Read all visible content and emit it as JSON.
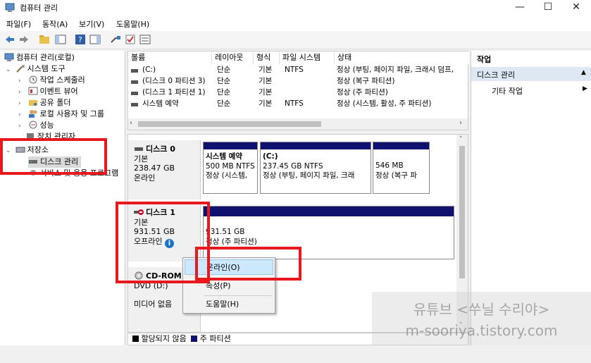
{
  "window": {
    "title": "컴퓨터 관리",
    "minimize": "—",
    "maximize": "☐",
    "close": "✕"
  },
  "menu": [
    "파일(F)",
    "동작(A)",
    "보기(V)",
    "도움말(H)"
  ],
  "tree": {
    "root": "컴퓨터 관리(로컬)",
    "system_tools": "시스템 도구",
    "task_scheduler": "작업 스케줄러",
    "event_viewer": "이벤트 뷰어",
    "shared_folders": "공유 폴더",
    "local_users": "로컬 사용자 및 그룹",
    "performance": "성능",
    "device_manager": "장치 관리자",
    "storage": "저장소",
    "disk_management": "디스크 관리",
    "services": "서비스 및 응용 프로그램"
  },
  "table": {
    "headers": [
      "볼륨",
      "레이아웃",
      "형식",
      "파일 시스템",
      "상태"
    ],
    "rows": [
      [
        "(C:)",
        "단순",
        "기본",
        "NTFS",
        "정상 (부팅, 페이지 파일, 크래시 덤프,"
      ],
      [
        "(디스크 0 파티션 3)",
        "단순",
        "기본",
        "",
        "정상 (복구 파티션)"
      ],
      [
        "(디스크 1 파티션 1)",
        "단순",
        "기본",
        "",
        "정상 (주 파티션)"
      ],
      [
        "시스템 예약",
        "단순",
        "기본",
        "NTFS",
        "정상 (시스템, 활성, 주 파티션)"
      ]
    ]
  },
  "disk0": {
    "name": "디스크 0",
    "type": "기본",
    "size": "238.47 GB",
    "status": "온라인",
    "partitions": [
      {
        "name": "시스템 예약",
        "size": "500 MB NTFS",
        "status": "정상 (시스템,"
      },
      {
        "name": "(C:)",
        "size": "237.45 GB NTFS",
        "status": "정상 (부팅, 페이지 파일, 크래"
      },
      {
        "name": "",
        "size": "546 MB",
        "status": "정상 (복구 파"
      }
    ]
  },
  "disk1": {
    "name": "디스크 1",
    "type": "기본",
    "size": "931.51 GB",
    "status": "오프라인",
    "partition": {
      "size": "931.51 GB",
      "status": "정상 (주 파티션)"
    }
  },
  "cdrom": {
    "name": "CD-ROM",
    "drive": "DVD (D:)",
    "status": "미디어 없음"
  },
  "legend": {
    "unallocated": "할당되지 않음",
    "primary": "주 파티션"
  },
  "actions": {
    "header": "작업",
    "section": "디스크 관리",
    "more": "기타 작업"
  },
  "context_menu": {
    "online": "온라인(O)",
    "properties": "속성(P)",
    "help": "도움말(H)"
  },
  "watermark": {
    "line1": "유튜브 <쑤닐 수리야>",
    "line2": "m-sooriya.tistory.com"
  },
  "colors": {
    "partition_bar": "#10106e",
    "highlight": "#cce8ff",
    "annotation": "#e8181f",
    "info_icon": "#1a73c8"
  }
}
